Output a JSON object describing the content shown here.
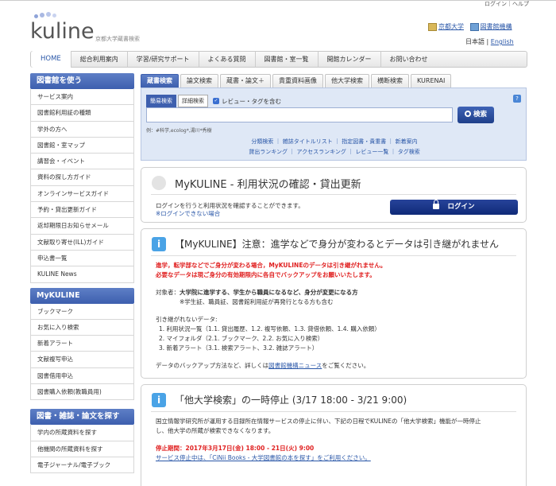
{
  "header": {
    "util_links": "ログイン｜ヘルプ",
    "logo_text": "kuline",
    "logo_subtitle": "京都大学蔵書検索",
    "university": "京都大学",
    "library_network": "図書館機構",
    "lang_ja": "日本語",
    "lang_sep": "|",
    "lang_en": "English"
  },
  "global_nav": [
    "HOME",
    "総合利用案内",
    "学習/研究サポート",
    "よくある質問",
    "図書館・室一覧",
    "開館カレンダー",
    "お問い合わせ"
  ],
  "sidebar": {
    "sections": [
      {
        "title": "図書館を使う",
        "items": [
          "サービス案内",
          "図書館利用証の種類",
          "学外の方へ",
          "図書館・室マップ",
          "講習会・イベント",
          "資料の探し方ガイド",
          "オンラインサービスガイド",
          "予約・貸出更新ガイド",
          "返却期限日お知らせメール",
          "文献取り寄せ(ILL)ガイド",
          "申込書一覧",
          "KULINE News"
        ]
      },
      {
        "title": "MyKULINE",
        "items": [
          "ブックマーク",
          "お気に入り検索",
          "新着アラート",
          "文献複写申込",
          "図書借用申込",
          "図書購入依頼(教職員用)"
        ]
      },
      {
        "title": "図書・雑誌・論文を探す",
        "items": [
          "学内の所蔵資料を探す",
          "他機関の所蔵資料を探す",
          "電子ジャーナル/電子ブック"
        ]
      }
    ]
  },
  "search_tabs": [
    "蔵書検索",
    "論文検索",
    "蔵書・論文＋",
    "貴重資料画像",
    "他大学検索",
    "横断検索",
    "KURENAI"
  ],
  "search": {
    "subtabs": [
      "簡易検索",
      "詳細検索"
    ],
    "checkbox_label": "レビュー・タグを含む",
    "help": "?",
    "button": "検索",
    "example": "例：#科学,ecolog*,湯川*秀樹",
    "links_row1": "分類検索 ｜ 雑誌タイトルリスト ｜ 指定図書・貴重書 ｜ 新着案内",
    "links_row2": "貸出ランキング ｜ アクセスランキング ｜ レビュー一覧 ｜ タグ検索"
  },
  "mykuline_panel": {
    "title": "MyKULINE - 利用状況の確認・貸出更新",
    "text": "ログインを行うと利用状況を確認することができます。",
    "link": "※ログインできない場合",
    "login_button": "ログイン"
  },
  "notice_panel": {
    "title": "【MyKULINE】注意：進学などで身分が変わるとデータは引き継がれません",
    "red1": "進学，転学部などでご身分が変わる場合，MyKULINEのデータは引き継がれません。",
    "red2": "必要なデータは現ご身分の有効期限内に各自でバックアップをお願いいたします。",
    "target_label": "対象者：",
    "target_text": "大学院に進学する、学生から職員になるなど、身分が変更になる方",
    "target_note": "※学生証、職員証、図書館利用証が再発行となる方も含む",
    "data_label": "引き継がれないデータ:",
    "data_items": [
      "1. 利用状況一覧（1.1. 貸出履歴、1.2. 複写依頼、1.3. 貸借依頼、1.4. 購入依頼）",
      "2. マイフォルダ（2.1. ブックマーク、2.2. お気に入り検索）",
      "3. 新着アラート（3.1. 検索アラート、3.2. 雑誌アラート）"
    ],
    "backup_pre": "データのバックアップ方法など、詳しくは",
    "backup_link": "図書館機構ニュース",
    "backup_post": "をご覧ください。"
  },
  "suspension_panel": {
    "title": "「他大学検索」の一時停止 (3/17 18:00 - 3/21 9:00)",
    "text1": "国立情報学研究所が運用する目録所在情報サービスの停止に伴い、下記の日程でKULINEの「他大学検索」機能が一時停止",
    "text2": "し、他大学の所蔵が検索できなくなります。",
    "date": "停止期間：2017年3月17日(金) 18:00 - 21日(火) 9:00",
    "cinii": "サービス停止中は、「CiNii Books - 大学図書館の本を探す」をご利用ください。"
  }
}
